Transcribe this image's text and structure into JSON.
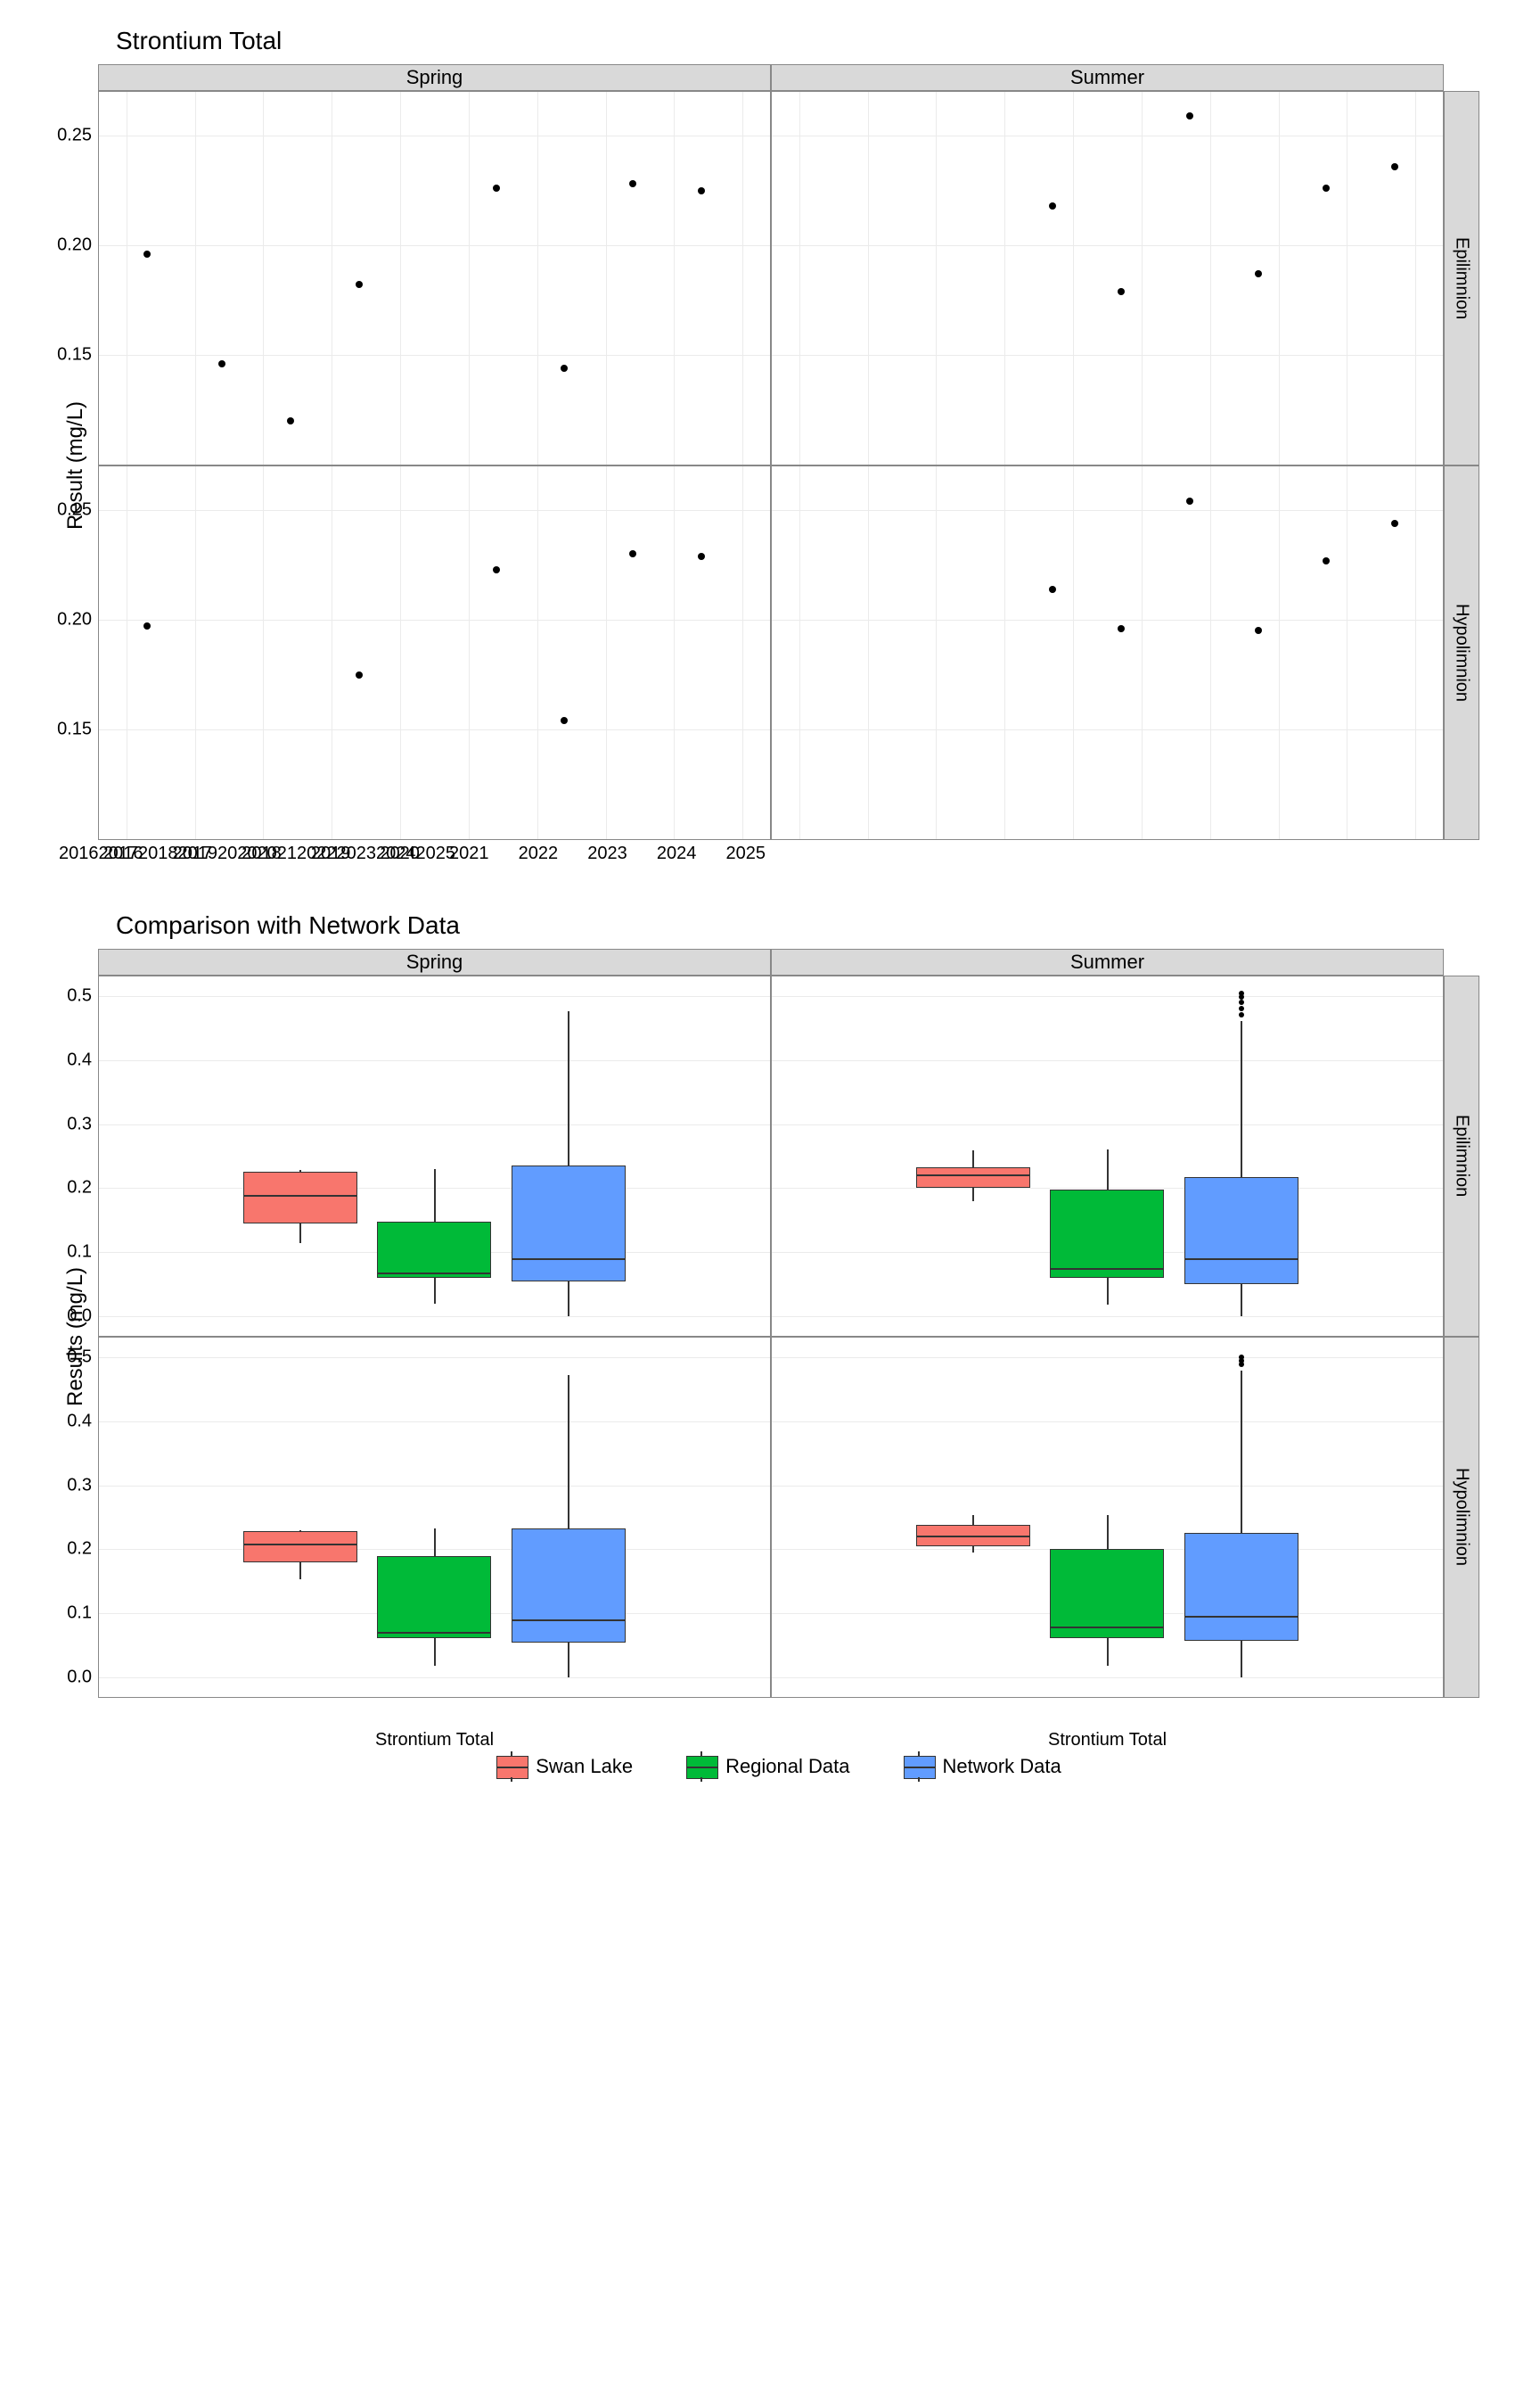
{
  "scatter": {
    "title": "Strontium Total",
    "ylabel": "Result (mg/L)",
    "col_facets": [
      "Spring",
      "Summer"
    ],
    "row_facets": [
      "Epilimnion",
      "Hypolimnion"
    ],
    "x_ticks": [
      2016,
      2017,
      2018,
      2019,
      2020,
      2021,
      2022,
      2023,
      2024,
      2025
    ],
    "y_ticks": [
      0.15,
      0.2,
      0.25
    ]
  },
  "boxplot": {
    "title": "Comparison with Network Data",
    "ylabel": "Results (mg/L)",
    "col_facets": [
      "Spring",
      "Summer"
    ],
    "row_facets": [
      "Epilimnion",
      "Hypolimnion"
    ],
    "y_ticks": [
      0.0,
      0.1,
      0.2,
      0.3,
      0.4,
      0.5
    ],
    "x_category": "Strontium Total",
    "legend": [
      "Swan Lake",
      "Regional Data",
      "Network Data"
    ]
  },
  "chart_data": [
    {
      "type": "scatter",
      "title": "Strontium Total",
      "ylabel": "Result (mg/L)",
      "xlim": [
        2015.6,
        2025.4
      ],
      "ylim": [
        0.1,
        0.27
      ],
      "facets": [
        {
          "col": "Spring",
          "row": "Epilimnion",
          "points": [
            {
              "x": 2016.3,
              "y": 0.196
            },
            {
              "x": 2017.4,
              "y": 0.146
            },
            {
              "x": 2018.4,
              "y": 0.12
            },
            {
              "x": 2019.4,
              "y": 0.182
            },
            {
              "x": 2021.4,
              "y": 0.226
            },
            {
              "x": 2022.4,
              "y": 0.144
            },
            {
              "x": 2023.4,
              "y": 0.228
            },
            {
              "x": 2024.4,
              "y": 0.225
            }
          ]
        },
        {
          "col": "Summer",
          "row": "Epilimnion",
          "points": [
            {
              "x": 2019.7,
              "y": 0.218
            },
            {
              "x": 2020.7,
              "y": 0.179
            },
            {
              "x": 2021.7,
              "y": 0.259
            },
            {
              "x": 2022.7,
              "y": 0.187
            },
            {
              "x": 2023.7,
              "y": 0.226
            },
            {
              "x": 2024.7,
              "y": 0.236
            }
          ]
        },
        {
          "col": "Spring",
          "row": "Hypolimnion",
          "points": [
            {
              "x": 2016.3,
              "y": 0.197
            },
            {
              "x": 2019.4,
              "y": 0.175
            },
            {
              "x": 2021.4,
              "y": 0.223
            },
            {
              "x": 2022.4,
              "y": 0.154
            },
            {
              "x": 2023.4,
              "y": 0.23
            },
            {
              "x": 2024.4,
              "y": 0.229
            }
          ]
        },
        {
          "col": "Summer",
          "row": "Hypolimnion",
          "points": [
            {
              "x": 2019.7,
              "y": 0.214
            },
            {
              "x": 2020.7,
              "y": 0.196
            },
            {
              "x": 2021.7,
              "y": 0.254
            },
            {
              "x": 2022.7,
              "y": 0.195
            },
            {
              "x": 2023.7,
              "y": 0.227
            },
            {
              "x": 2024.7,
              "y": 0.244
            }
          ]
        }
      ]
    },
    {
      "type": "box",
      "title": "Comparison with Network Data",
      "ylabel": "Results (mg/L)",
      "ylim": [
        -0.03,
        0.53
      ],
      "groups": [
        "Swan Lake",
        "Regional Data",
        "Network Data"
      ],
      "facets": [
        {
          "col": "Spring",
          "row": "Epilimnion",
          "boxes": [
            {
              "group": "Swan Lake",
              "low": 0.115,
              "q1": 0.145,
              "med": 0.19,
              "q3": 0.225,
              "high": 0.228,
              "outliers": []
            },
            {
              "group": "Regional Data",
              "low": 0.02,
              "q1": 0.06,
              "med": 0.068,
              "q3": 0.148,
              "high": 0.23,
              "outliers": []
            },
            {
              "group": "Network Data",
              "low": 0.0,
              "q1": 0.055,
              "med": 0.09,
              "q3": 0.235,
              "high": 0.476,
              "outliers": []
            }
          ]
        },
        {
          "col": "Summer",
          "row": "Epilimnion",
          "boxes": [
            {
              "group": "Swan Lake",
              "low": 0.18,
              "q1": 0.2,
              "med": 0.222,
              "q3": 0.232,
              "high": 0.259,
              "outliers": []
            },
            {
              "group": "Regional Data",
              "low": 0.018,
              "q1": 0.06,
              "med": 0.075,
              "q3": 0.198,
              "high": 0.26,
              "outliers": []
            },
            {
              "group": "Network Data",
              "low": 0.0,
              "q1": 0.05,
              "med": 0.09,
              "q3": 0.218,
              "high": 0.46,
              "outliers": [
                0.47,
                0.48,
                0.49,
                0.498,
                0.504
              ]
            }
          ]
        },
        {
          "col": "Spring",
          "row": "Hypolimnion",
          "boxes": [
            {
              "group": "Swan Lake",
              "low": 0.154,
              "q1": 0.18,
              "med": 0.21,
              "q3": 0.228,
              "high": 0.23,
              "outliers": []
            },
            {
              "group": "Regional Data",
              "low": 0.018,
              "q1": 0.062,
              "med": 0.07,
              "q3": 0.19,
              "high": 0.232,
              "outliers": []
            },
            {
              "group": "Network Data",
              "low": 0.0,
              "q1": 0.055,
              "med": 0.09,
              "q3": 0.232,
              "high": 0.472,
              "outliers": []
            }
          ]
        },
        {
          "col": "Summer",
          "row": "Hypolimnion",
          "boxes": [
            {
              "group": "Swan Lake",
              "low": 0.195,
              "q1": 0.205,
              "med": 0.222,
              "q3": 0.238,
              "high": 0.254,
              "outliers": []
            },
            {
              "group": "Regional Data",
              "low": 0.018,
              "q1": 0.062,
              "med": 0.078,
              "q3": 0.2,
              "high": 0.254,
              "outliers": []
            },
            {
              "group": "Network Data",
              "low": 0.0,
              "q1": 0.058,
              "med": 0.096,
              "q3": 0.225,
              "high": 0.478,
              "outliers": [
                0.488,
                0.494,
                0.5
              ]
            }
          ]
        }
      ]
    }
  ]
}
